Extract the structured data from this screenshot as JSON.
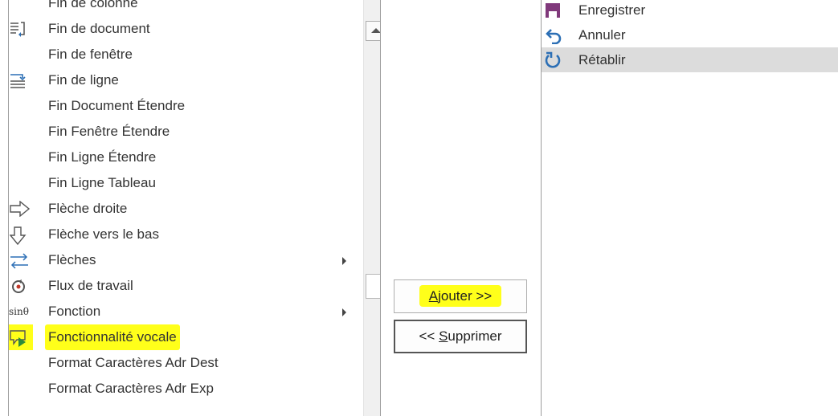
{
  "commands": [
    {
      "label": "Fin de colonne",
      "icon": "none",
      "has_submenu": false,
      "highlighted": false
    },
    {
      "label": "Fin de document",
      "icon": "document-end-icon",
      "has_submenu": false,
      "highlighted": false
    },
    {
      "label": "Fin de fenêtre",
      "icon": "none",
      "has_submenu": false,
      "highlighted": false
    },
    {
      "label": "Fin de ligne",
      "icon": "line-end-icon",
      "has_submenu": false,
      "highlighted": false
    },
    {
      "label": "Fin Document Étendre",
      "icon": "none",
      "has_submenu": false,
      "highlighted": false
    },
    {
      "label": "Fin Fenêtre Étendre",
      "icon": "none",
      "has_submenu": false,
      "highlighted": false
    },
    {
      "label": "Fin Ligne Étendre",
      "icon": "none",
      "has_submenu": false,
      "highlighted": false
    },
    {
      "label": "Fin Ligne Tableau",
      "icon": "none",
      "has_submenu": false,
      "highlighted": false
    },
    {
      "label": "Flèche droite",
      "icon": "arrow-right-icon",
      "has_submenu": false,
      "highlighted": false
    },
    {
      "label": "Flèche vers le bas",
      "icon": "arrow-down-icon",
      "has_submenu": false,
      "highlighted": false
    },
    {
      "label": "Flèches",
      "icon": "arrows-icon",
      "has_submenu": true,
      "highlighted": false
    },
    {
      "label": "Flux de travail",
      "icon": "workflow-icon",
      "has_submenu": false,
      "highlighted": false
    },
    {
      "label": "Fonction",
      "icon": "function-icon",
      "icon_text": "sinθ",
      "has_submenu": true,
      "highlighted": false
    },
    {
      "label": "Fonctionnalité vocale",
      "icon": "speech-icon",
      "has_submenu": false,
      "highlighted": true
    },
    {
      "label": "Format Caractères Adr Dest",
      "icon": "none",
      "has_submenu": false,
      "highlighted": false
    },
    {
      "label": "Format Caractères Adr Exp",
      "icon": "none",
      "has_submenu": false,
      "highlighted": false
    }
  ],
  "buttons": {
    "add": {
      "accel": "A",
      "rest": "jouter >>"
    },
    "remove": {
      "prefix": "<< ",
      "accel": "S",
      "rest": "upprimer"
    }
  },
  "quick_access": [
    {
      "label": "Enregistrer",
      "icon": "save-icon",
      "selected": false
    },
    {
      "label": "Annuler",
      "icon": "undo-icon",
      "selected": false
    },
    {
      "label": "Rétablir",
      "icon": "redo-icon",
      "selected": true
    }
  ],
  "colors": {
    "highlight": "#ffff1a",
    "selection": "#dcdcdc",
    "save_icon": "#80397b",
    "undo_icon": "#2c6fb5"
  }
}
